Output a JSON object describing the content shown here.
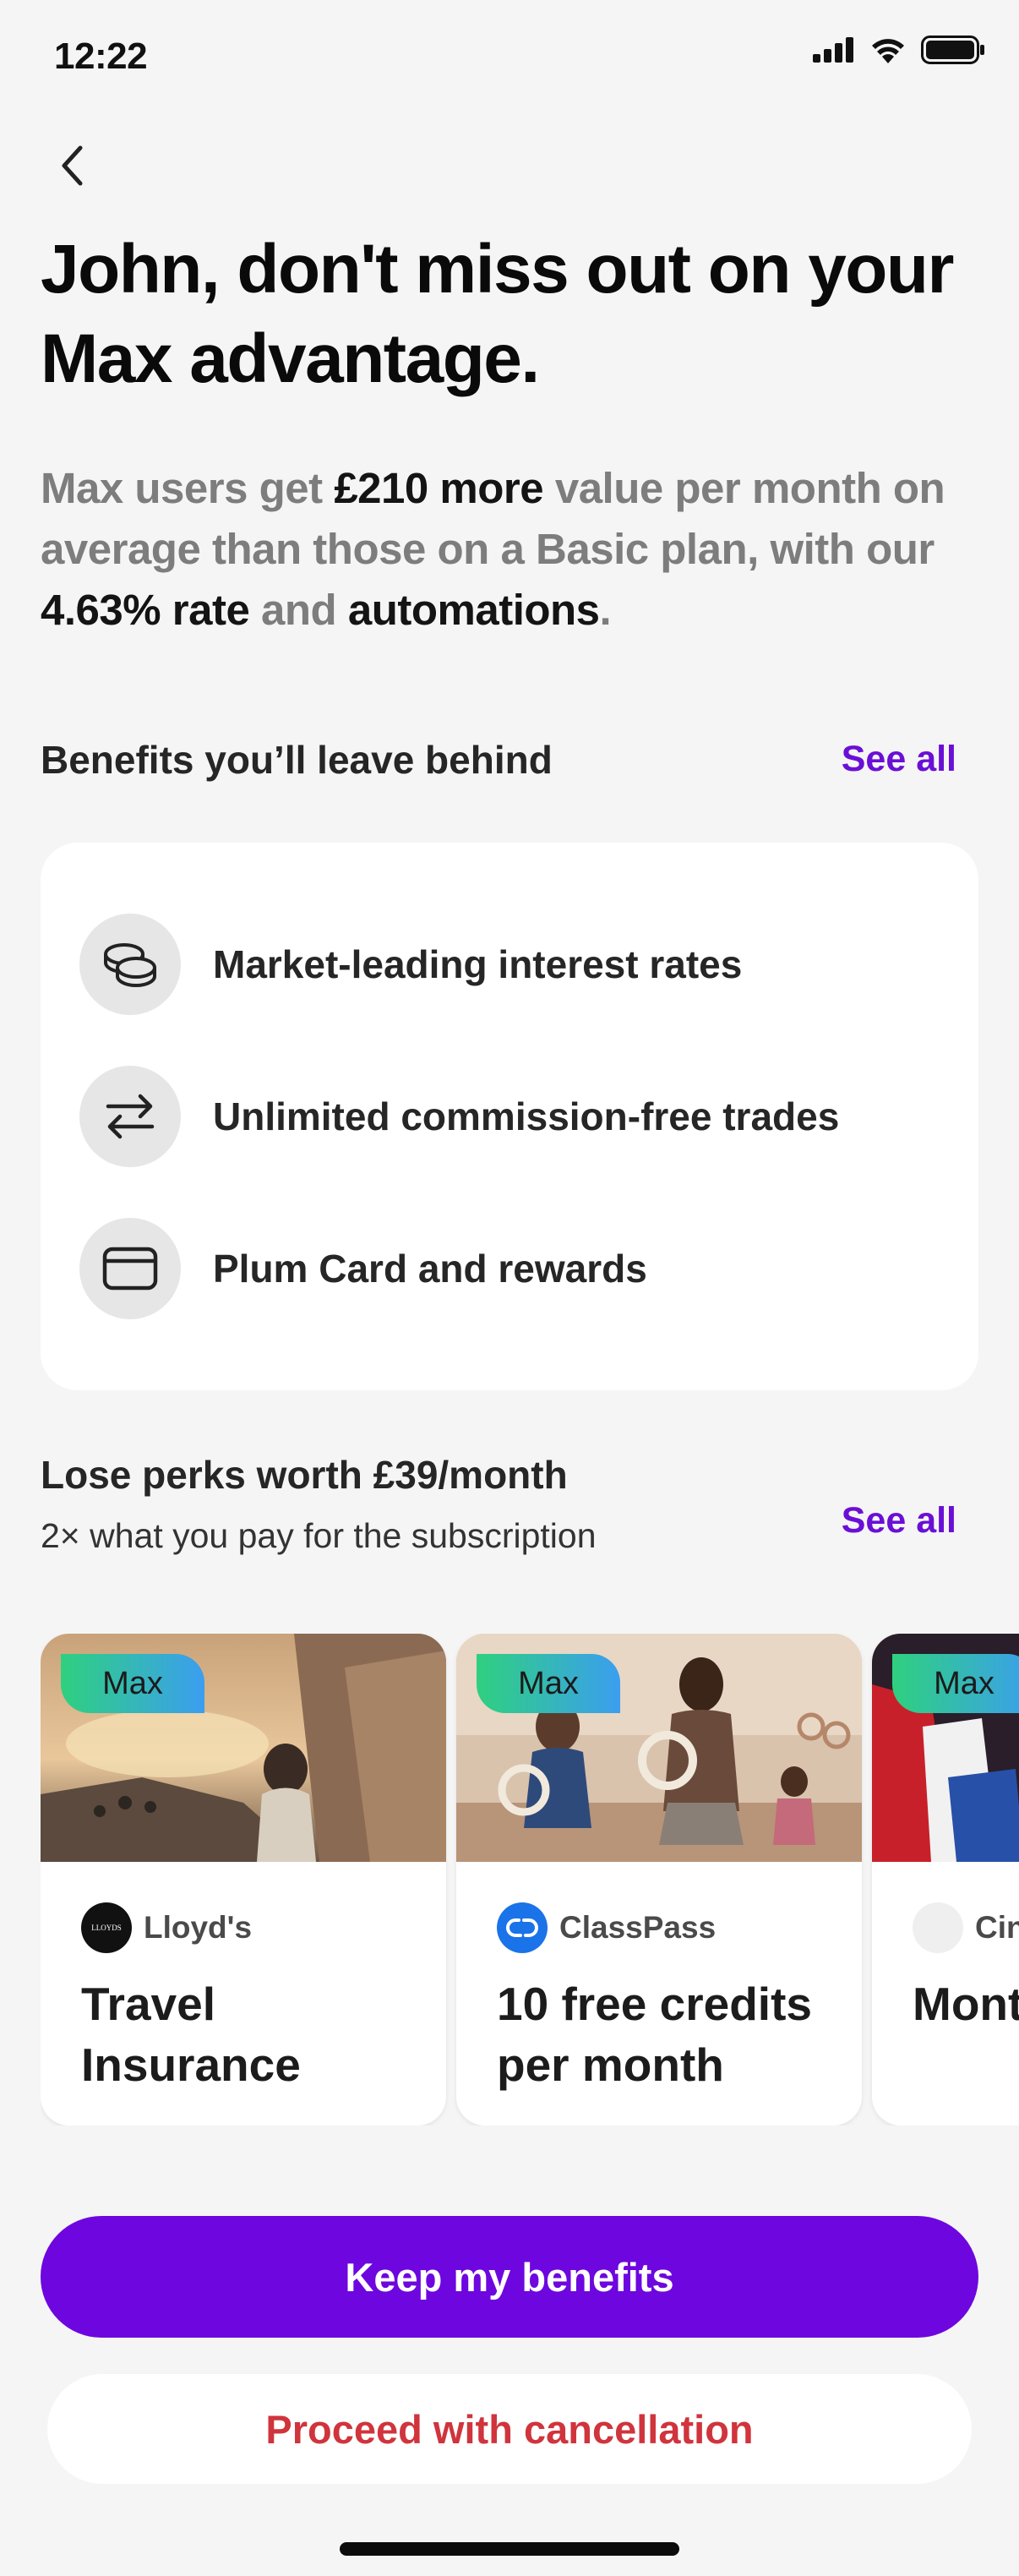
{
  "status_bar": {
    "time": "12:22"
  },
  "headline": "John, don't miss out on your Max advantage.",
  "intro": {
    "p1": "Max users get ",
    "h1": "£210 more",
    "p2": " value per month on average than those on a Basic plan, with our ",
    "h2": "4.63% rate",
    "p3": " and ",
    "h3": "automations",
    "p4": "."
  },
  "benefits": {
    "title": "Benefits you’ll leave behind",
    "see_all": "See all",
    "items": [
      {
        "label": "Market-leading interest rates",
        "icon": "coins-icon"
      },
      {
        "label": "Unlimited commission-free trades",
        "icon": "swap-arrows-icon"
      },
      {
        "label": "Plum Card and rewards",
        "icon": "card-icon"
      }
    ]
  },
  "perks": {
    "title": "Lose perks worth £39/month",
    "subtitle": "2× what you pay for the subscription",
    "see_all": "See all",
    "items": [
      {
        "badge": "Max",
        "brand": "Lloyd's",
        "logo_text": "LLOYDS",
        "title": "Travel Insurance"
      },
      {
        "badge": "Max",
        "brand": "ClassPass",
        "title": "10 free credits per month"
      },
      {
        "badge": "Max",
        "brand": "Cin",
        "title": "Mont ciner"
      }
    ]
  },
  "actions": {
    "primary": "Keep my benefits",
    "secondary": "Proceed with cancellation"
  },
  "colors": {
    "accent": "#6e06df",
    "danger": "#d0343c",
    "badge_gradient_start": "#2fd07f",
    "badge_gradient_end": "#3b9ef0"
  }
}
